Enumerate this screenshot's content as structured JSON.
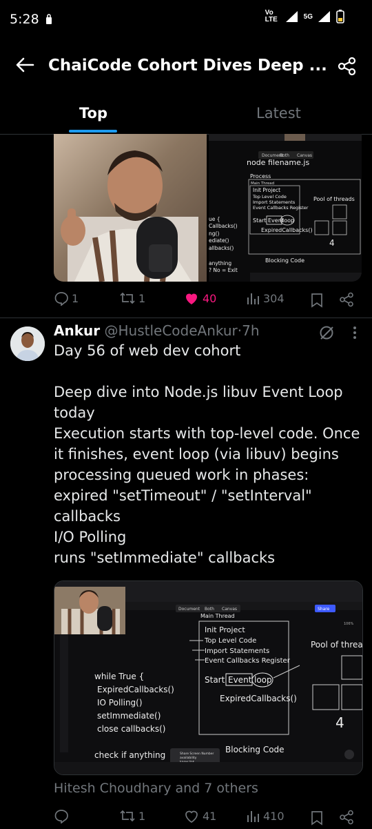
{
  "status_bar": {
    "time": "5:28",
    "network": "Vo LTE",
    "signal": "5G"
  },
  "header": {
    "title": "ChaiCode Cohort Dives Deep ...",
    "back_icon": "arrow-left-icon",
    "share_icon": "share-icon"
  },
  "tabs": [
    {
      "label": "Top",
      "active": true
    },
    {
      "label": "Latest",
      "active": false
    }
  ],
  "post1": {
    "media_board": {
      "title": "node filename.js",
      "process": "Process",
      "main_thread": "Main Thread",
      "items": [
        "Init Project",
        "Top Level Code",
        "Import Statements",
        "Event Callbacks Register"
      ],
      "start": "Start",
      "event": "Event",
      "loop": "loop",
      "expired": "ExpiredCallbacks()",
      "pool": "Pool of threads",
      "pool_count": "4",
      "blocking": "Blocking Code",
      "left_snips": [
        "ue {",
        "Callbacks()",
        "ng()",
        "ediate()",
        "allbacks()",
        "anything",
        "? No = Exit"
      ],
      "tabs": [
        "Document",
        "Both",
        "Canvas"
      ]
    },
    "actions": {
      "replies": "1",
      "reposts": "1",
      "likes": "40",
      "views": "304"
    },
    "accent": "#f91880"
  },
  "post2": {
    "name": "Ankur",
    "handle": "@HustleCodeAnkur",
    "dot": "·",
    "time": "7h",
    "body": [
      "Day 56 of web dev cohort",
      "",
      "Deep dive into Node.js libuv Event Loop",
      "today",
      "Execution starts with top-level code. Once",
      "it finishes, event loop (via libuv) begins",
      "processing queued work in phases:",
      "expired \"setTimeout\" / \"setInterval\"",
      "callbacks",
      "I/O Polling",
      "runs \"setImmediate\" callbacks"
    ],
    "media_board": {
      "tabs": [
        "Document",
        "Both",
        "Canvas"
      ],
      "share": "Share",
      "zoom": "106%",
      "main_thread": "Main Thread",
      "items": [
        "Init Project",
        "Top Level Code",
        "Import Statements",
        "Event Callbacks Register"
      ],
      "start": "Start",
      "event": "Event",
      "loop": "loop",
      "expired": "ExpiredCallbacks()",
      "pool": "Pool of threa",
      "pool_count": "4",
      "blocking": "Blocking Code",
      "code": [
        "while True {",
        "ExpiredCallbacks()",
        "IO Polling()",
        "setImmediate()",
        "close callbacks()"
      ],
      "check": "check if anything",
      "toast_line1": "Share Screen Number",
      "toast_line2": "availability",
      "toast_line3": "know link"
    },
    "social_context": "Hitesh Choudhary and 7 others",
    "actions": {
      "reposts": "1",
      "likes": "41",
      "views": "410"
    }
  }
}
